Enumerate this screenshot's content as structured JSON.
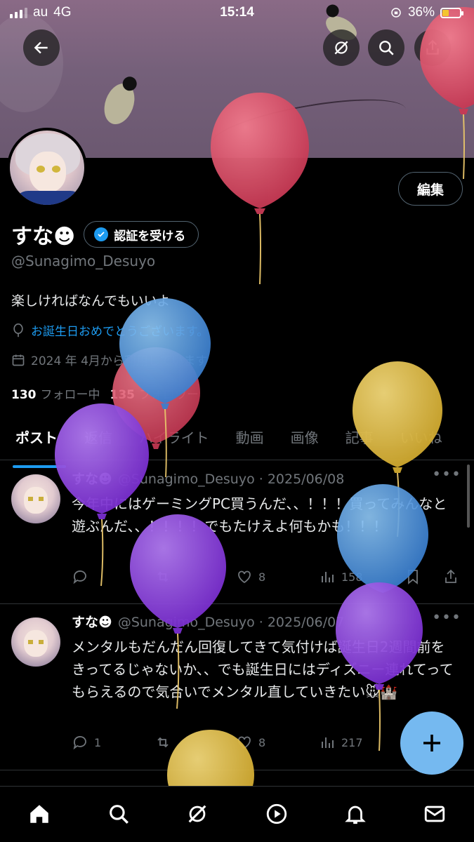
{
  "status_bar": {
    "carrier": "au",
    "network": "4G",
    "time": "15:14",
    "battery": "36%",
    "battery_level": 0.36
  },
  "header_buttons": {
    "back": "arrow-left-icon",
    "grok": "grok-icon",
    "search": "search-icon",
    "share": "share-icon"
  },
  "profile": {
    "edit_label": "編集",
    "name": "すな☻",
    "verify_label": "認証を受ける",
    "handle": "@Sunagimo_Desuyo",
    "bio": "楽しければなんでもいいよ",
    "birthday_text": "お誕生日おめでとうございます。",
    "joined_text": "2024 年 4月から利用しています",
    "following_count": "130",
    "following_label": "フォロー中",
    "followers_count": "135",
    "followers_label": "フォロワー"
  },
  "tabs": [
    {
      "label": "ポスト",
      "active": true
    },
    {
      "label": "返信",
      "active": false
    },
    {
      "label": "ハイライト",
      "active": false
    },
    {
      "label": "動画",
      "active": false
    },
    {
      "label": "画像",
      "active": false
    },
    {
      "label": "記事",
      "active": false
    },
    {
      "label": "いいね",
      "active": false
    }
  ],
  "posts": [
    {
      "name": "すな☻",
      "meta": "@Sunagimo_Desuyo · 2025/06/08",
      "text": "今年中にはゲーミングPC買うんだ、、！！！買ってみんなと遊ぶんだ、、！！！！でもたけえよ何もかも！！！",
      "replies": "",
      "reposts": "",
      "likes": "8",
      "views": "158"
    },
    {
      "name": "すな☻",
      "meta": "@Sunagimo_Desuyo · 2025/06/07",
      "text": "メンタルもだんだん回復してきて気付けば誕生日2週間前をきってるじゃないか、、でも誕生日にはディズニー連れてってもらえるので気合いでメンタル直していきたい🐭🏰",
      "replies": "1",
      "reposts": "",
      "likes": "8",
      "views": "217"
    }
  ],
  "colors": {
    "accent": "#1d9bf0",
    "fab": "#75b9f0",
    "balloon_red": "#d94a63",
    "balloon_blue": "#4a90d9",
    "balloon_purple": "#8a3dd6",
    "balloon_yellow": "#dcb93f"
  },
  "bottom_nav": [
    "home-icon",
    "search-icon",
    "grok-icon",
    "video-icon",
    "notifications-icon",
    "messages-icon"
  ]
}
